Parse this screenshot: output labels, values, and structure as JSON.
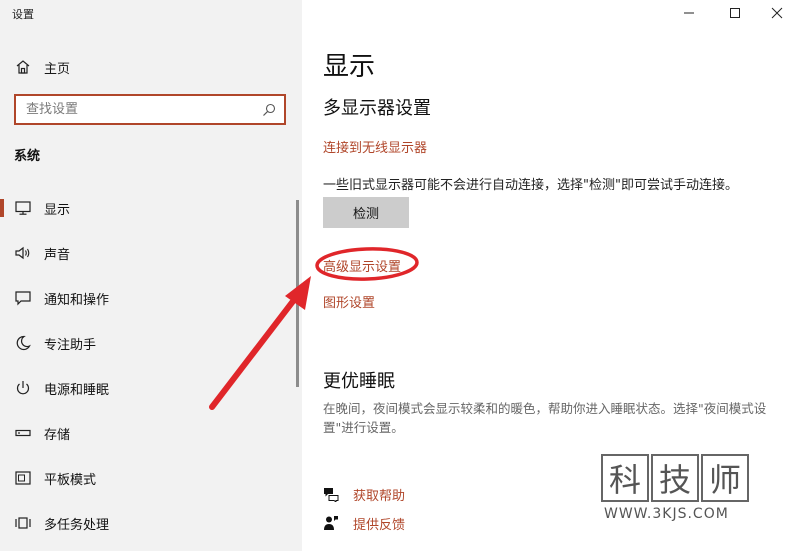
{
  "window": {
    "title": "设置"
  },
  "sidebar": {
    "home_label": "主页",
    "search_placeholder": "查找设置",
    "section_label": "系统",
    "items": [
      {
        "label": "显示",
        "icon": "monitor-icon",
        "active": true
      },
      {
        "label": "声音",
        "icon": "speaker-icon",
        "active": false
      },
      {
        "label": "通知和操作",
        "icon": "notification-icon",
        "active": false
      },
      {
        "label": "专注助手",
        "icon": "moon-icon",
        "active": false
      },
      {
        "label": "电源和睡眠",
        "icon": "power-icon",
        "active": false
      },
      {
        "label": "存储",
        "icon": "storage-icon",
        "active": false
      },
      {
        "label": "平板模式",
        "icon": "tablet-mode-icon",
        "active": false
      },
      {
        "label": "多任务处理",
        "icon": "multitasking-icon",
        "active": false
      }
    ]
  },
  "main": {
    "page_title": "显示",
    "multi_display_heading": "多显示器设置",
    "connect_wireless_link": "连接到无线显示器",
    "legacy_note": "一些旧式显示器可能不会进行自动连接，选择\"检测\"即可尝试手动连接。",
    "detect_button": "检测",
    "advanced_display_link": "高级显示设置",
    "graphics_link": "图形设置",
    "sleep_heading": "更优睡眠",
    "sleep_desc": "在晚间，夜间模式会显示较柔和的暖色，帮助你进入睡眠状态。选择\"夜间模式设置\"进行设置。",
    "get_help_link": "获取帮助",
    "feedback_link": "提供反馈"
  },
  "watermark": {
    "chars": [
      "科",
      "技",
      "师"
    ],
    "url": "WWW.3KJS.COM"
  },
  "colors": {
    "accent": "#b0462a",
    "annotation_red": "#e0262a",
    "sidebar_bg": "#f2f2f2"
  }
}
